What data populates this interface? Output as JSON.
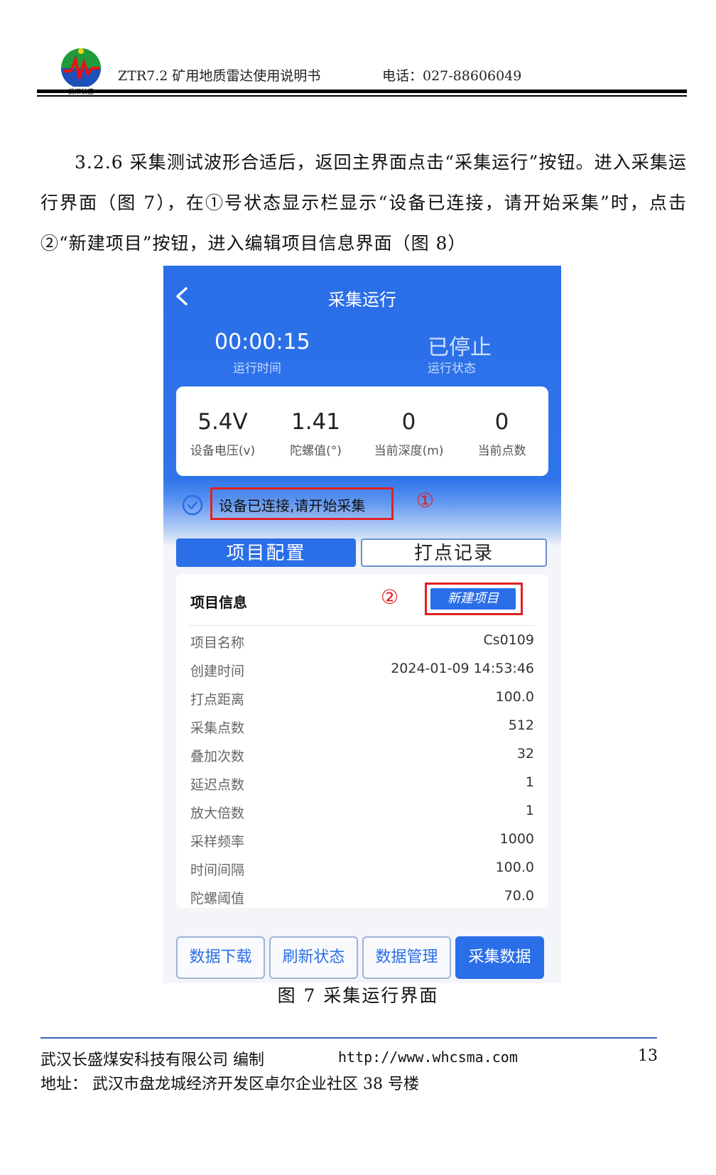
{
  "header": {
    "doc_title": "ZTR7.2 矿用地质雷达使用说明书",
    "phone": "电话：027-88606049",
    "logo_text": "武汉长盛"
  },
  "paragraph": "3.2.6 采集测试波形合适后，返回主界面点击“采集运行”按钮。进入采集运行界面（图 7），在①号状态显示栏显示“设备已连接，请开始采集”时，点击②“新建项目”按钮，进入编辑项目信息界面（图 8）",
  "app": {
    "title": "采集运行",
    "run_time": "00:00:15",
    "run_time_label": "运行时间",
    "run_state": "已停止",
    "run_state_label": "运行状态",
    "metrics": [
      {
        "value": "5.4V",
        "label": "设备电压(v)"
      },
      {
        "value": "1.41",
        "label": "陀螺值(°)"
      },
      {
        "value": "0",
        "label": "当前深度(m)"
      },
      {
        "value": "0",
        "label": "当前点数"
      }
    ],
    "status_text": "设备已连接,请开始采集",
    "marker_1": "①",
    "marker_2": "②",
    "tabs": [
      "项目配置",
      "打点记录"
    ],
    "info_title": "项目信息",
    "new_project_label": "新建项目",
    "info_rows": [
      {
        "key": "项目名称",
        "value": "Cs0109"
      },
      {
        "key": "创建时间",
        "value": "2024-01-09 14:53:46"
      },
      {
        "key": "打点距离",
        "value": "100.0"
      },
      {
        "key": "采集点数",
        "value": "512"
      },
      {
        "key": "叠加次数",
        "value": "32"
      },
      {
        "key": "延迟点数",
        "value": "1"
      },
      {
        "key": "放大倍数",
        "value": "1"
      },
      {
        "key": "采样频率",
        "value": "1000"
      },
      {
        "key": "时间间隔",
        "value": "100.0"
      },
      {
        "key": "陀螺阈值",
        "value": "70.0"
      }
    ],
    "bottom_buttons": [
      "数据下载",
      "刷新状态",
      "数据管理",
      "采集数据"
    ],
    "colors": {
      "primary": "#2a6ee8",
      "highlight": "#e02020"
    }
  },
  "caption": "图 7 采集运行界面",
  "footer": {
    "company": "武汉长盛煤安科技有限公司 编制",
    "website": "http://www.whcsma.com",
    "page_number": "13",
    "address": "地址： 武汉市盘龙城经济开发区卓尔企业社区 38 号楼"
  }
}
